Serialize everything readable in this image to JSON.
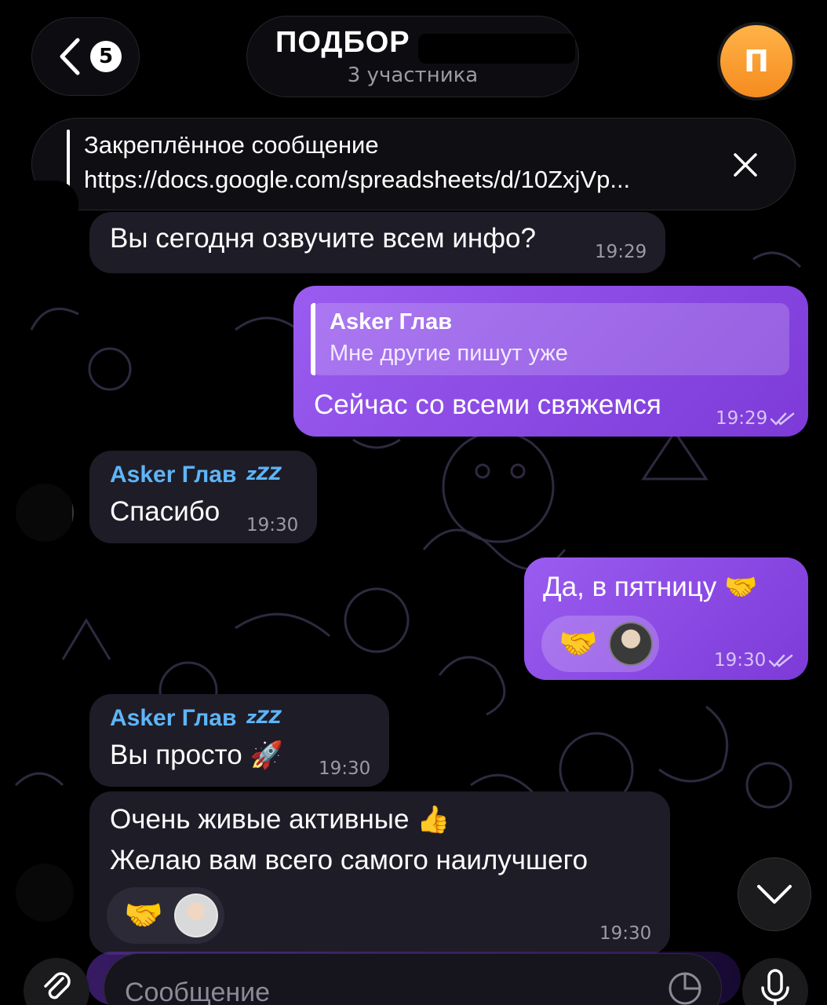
{
  "header": {
    "back_count": "5",
    "title": "ПОДБОР",
    "subtitle": "3 участника",
    "avatar_letter": "П"
  },
  "pinned": {
    "title": "Закреплённое сообщение",
    "text": "https://docs.google.com/spreadsheets/d/10ZxjVp..."
  },
  "messages": [
    {
      "text": "Вы сегодня озвучите всем инфо?",
      "time": "19:29"
    },
    {
      "reply_sender": "Asker Глав",
      "reply_text": "Мне другие пишут уже",
      "text": "Сейчас со всеми свяжемся",
      "time": "19:29"
    },
    {
      "sender": "Asker Глав",
      "text": "Спасибо",
      "time": "19:30"
    },
    {
      "text": "Да, в пятницу",
      "emoji": "🤝",
      "reaction": "🤝",
      "time": "19:30"
    },
    {
      "sender": "Asker Глав",
      "text": "Вы просто",
      "emoji": "🚀",
      "time": "19:30"
    },
    {
      "line1": "Очень живые активные",
      "emoji": "👍",
      "line2": "Желаю вам всего самого наилучшего",
      "reaction": "🤝",
      "time": "19:30"
    }
  ],
  "input": {
    "placeholder": "Сообщение"
  },
  "colors": {
    "outgoing": "#8a4ae6",
    "incoming": "#1e1c27",
    "sender_name": "#5eb5f7",
    "avatar": "#f59a2a"
  },
  "icons": [
    "back-chevron-icon",
    "close-icon",
    "double-check-icon",
    "sleep-zzz-icon",
    "chevron-down-icon",
    "paperclip-icon",
    "sticker-icon",
    "microphone-icon"
  ]
}
